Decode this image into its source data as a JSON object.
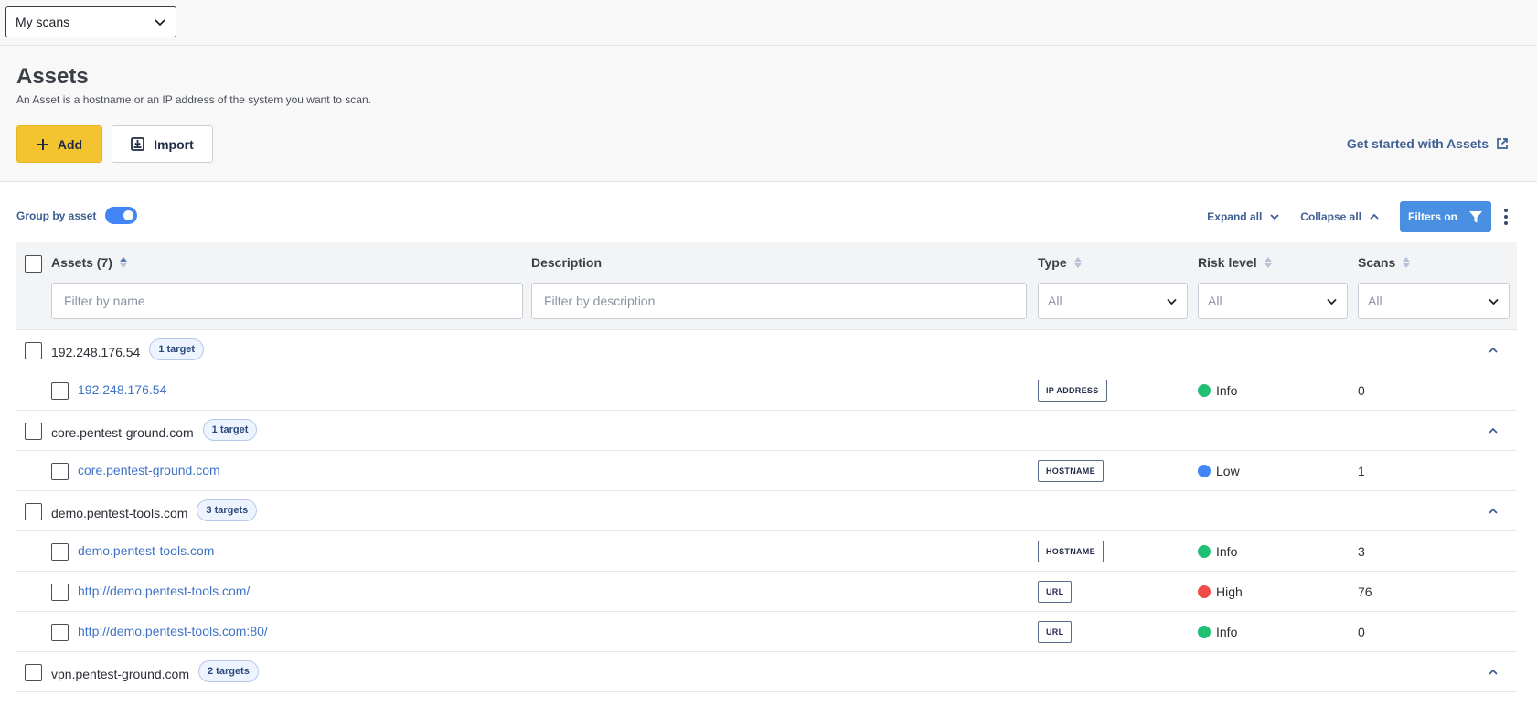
{
  "topbar": {
    "scope_select": "My scans"
  },
  "header": {
    "title": "Assets",
    "subtitle": "An Asset is a hostname or an IP address of the system you want to scan.",
    "add_label": "Add",
    "import_label": "Import",
    "get_started_label": "Get started with Assets"
  },
  "toolbar": {
    "group_by_label": "Group by asset",
    "group_by_enabled": true,
    "expand_all_label": "Expand all",
    "collapse_all_label": "Collapse all",
    "filters_label": "Filters on"
  },
  "table": {
    "columns": {
      "assets": "Assets (7)",
      "description": "Description",
      "type": "Type",
      "risk": "Risk level",
      "scans": "Scans"
    },
    "filters": {
      "name_placeholder": "Filter by name",
      "description_placeholder": "Filter by description",
      "type_value": "All",
      "risk_value": "All",
      "scans_value": "All"
    },
    "groups": [
      {
        "name": "192.248.176.54",
        "badge": "1 target",
        "children": [
          {
            "name": "192.248.176.54",
            "type": "IP ADDRESS",
            "risk": "Info",
            "scans": "0"
          }
        ]
      },
      {
        "name": "core.pentest-ground.com",
        "badge": "1 target",
        "children": [
          {
            "name": "core.pentest-ground.com",
            "type": "HOSTNAME",
            "risk": "Low",
            "scans": "1"
          }
        ]
      },
      {
        "name": "demo.pentest-tools.com",
        "badge": "3 targets",
        "children": [
          {
            "name": "demo.pentest-tools.com",
            "type": "HOSTNAME",
            "risk": "Info",
            "scans": "3"
          },
          {
            "name": "http://demo.pentest-tools.com/",
            "type": "URL",
            "risk": "High",
            "scans": "76"
          },
          {
            "name": "http://demo.pentest-tools.com:80/",
            "type": "URL",
            "risk": "Info",
            "scans": "0"
          }
        ]
      },
      {
        "name": "vpn.pentest-ground.com",
        "badge": "2 targets",
        "children": []
      }
    ]
  },
  "colors": {
    "accent_yellow": "#f4c430",
    "primary_blue": "#4a90e2",
    "risk_info": "#1fbf74",
    "risk_low": "#4285f4",
    "risk_high": "#ef4b4b"
  }
}
